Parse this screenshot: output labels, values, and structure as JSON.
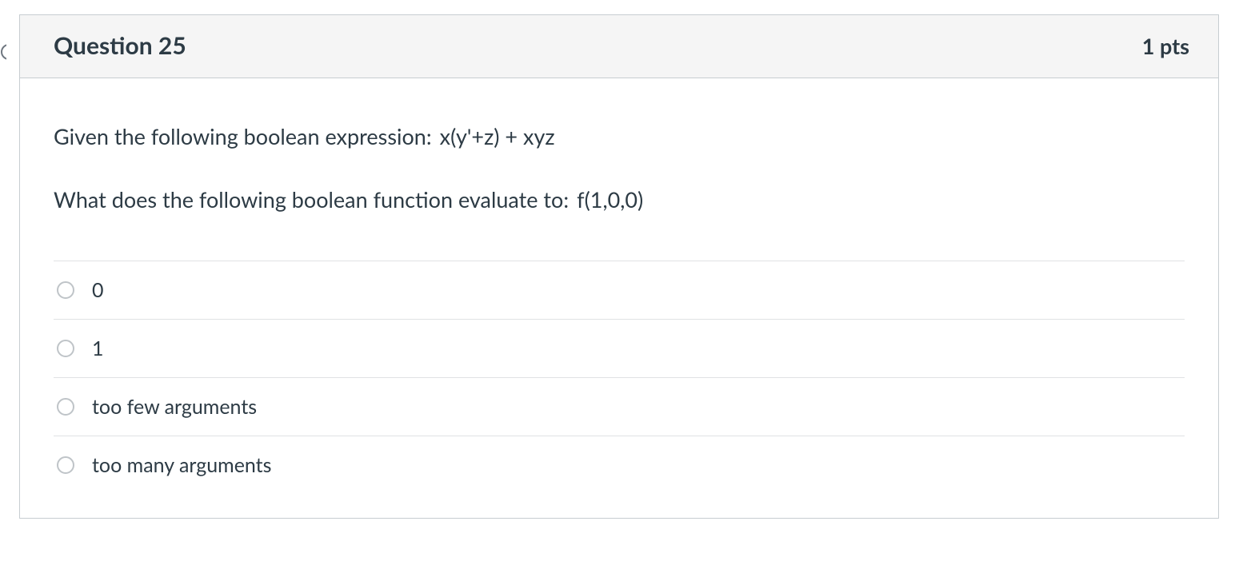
{
  "header": {
    "title": "Question 25",
    "points": "1 pts"
  },
  "prompt": {
    "line1_prefix": "Given the following boolean expression:",
    "line1_expr": "x(y'+z) + xyz",
    "line2_prefix": "What does the following boolean function evaluate to:",
    "line2_expr": "f(1,0,0)"
  },
  "answers": [
    {
      "label": "0"
    },
    {
      "label": "1"
    },
    {
      "label": "too few arguments"
    },
    {
      "label": "too many arguments"
    }
  ]
}
